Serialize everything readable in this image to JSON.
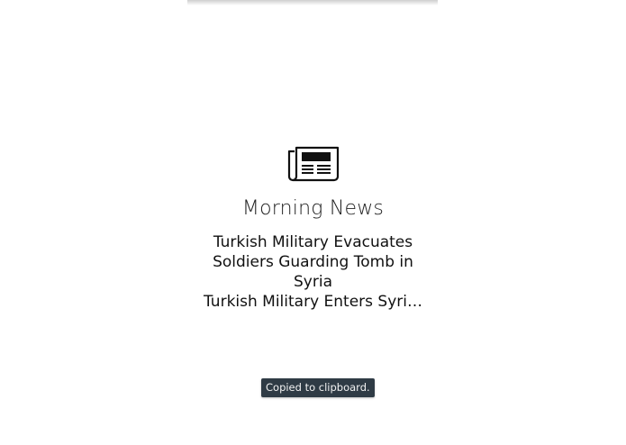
{
  "app": {
    "title": "Morning News",
    "icon": "newspaper-icon"
  },
  "headlines": [
    "Turkish Military Evacuates Soldiers Guarding Tomb in Syria",
    "Turkish Military Enters Syri…"
  ],
  "toast": {
    "message": "Copied to clipboard."
  },
  "colors": {
    "background": "#ffffff",
    "text": "#111111",
    "toast_background": "#2f3b45",
    "toast_text": "#f2f2f2"
  }
}
